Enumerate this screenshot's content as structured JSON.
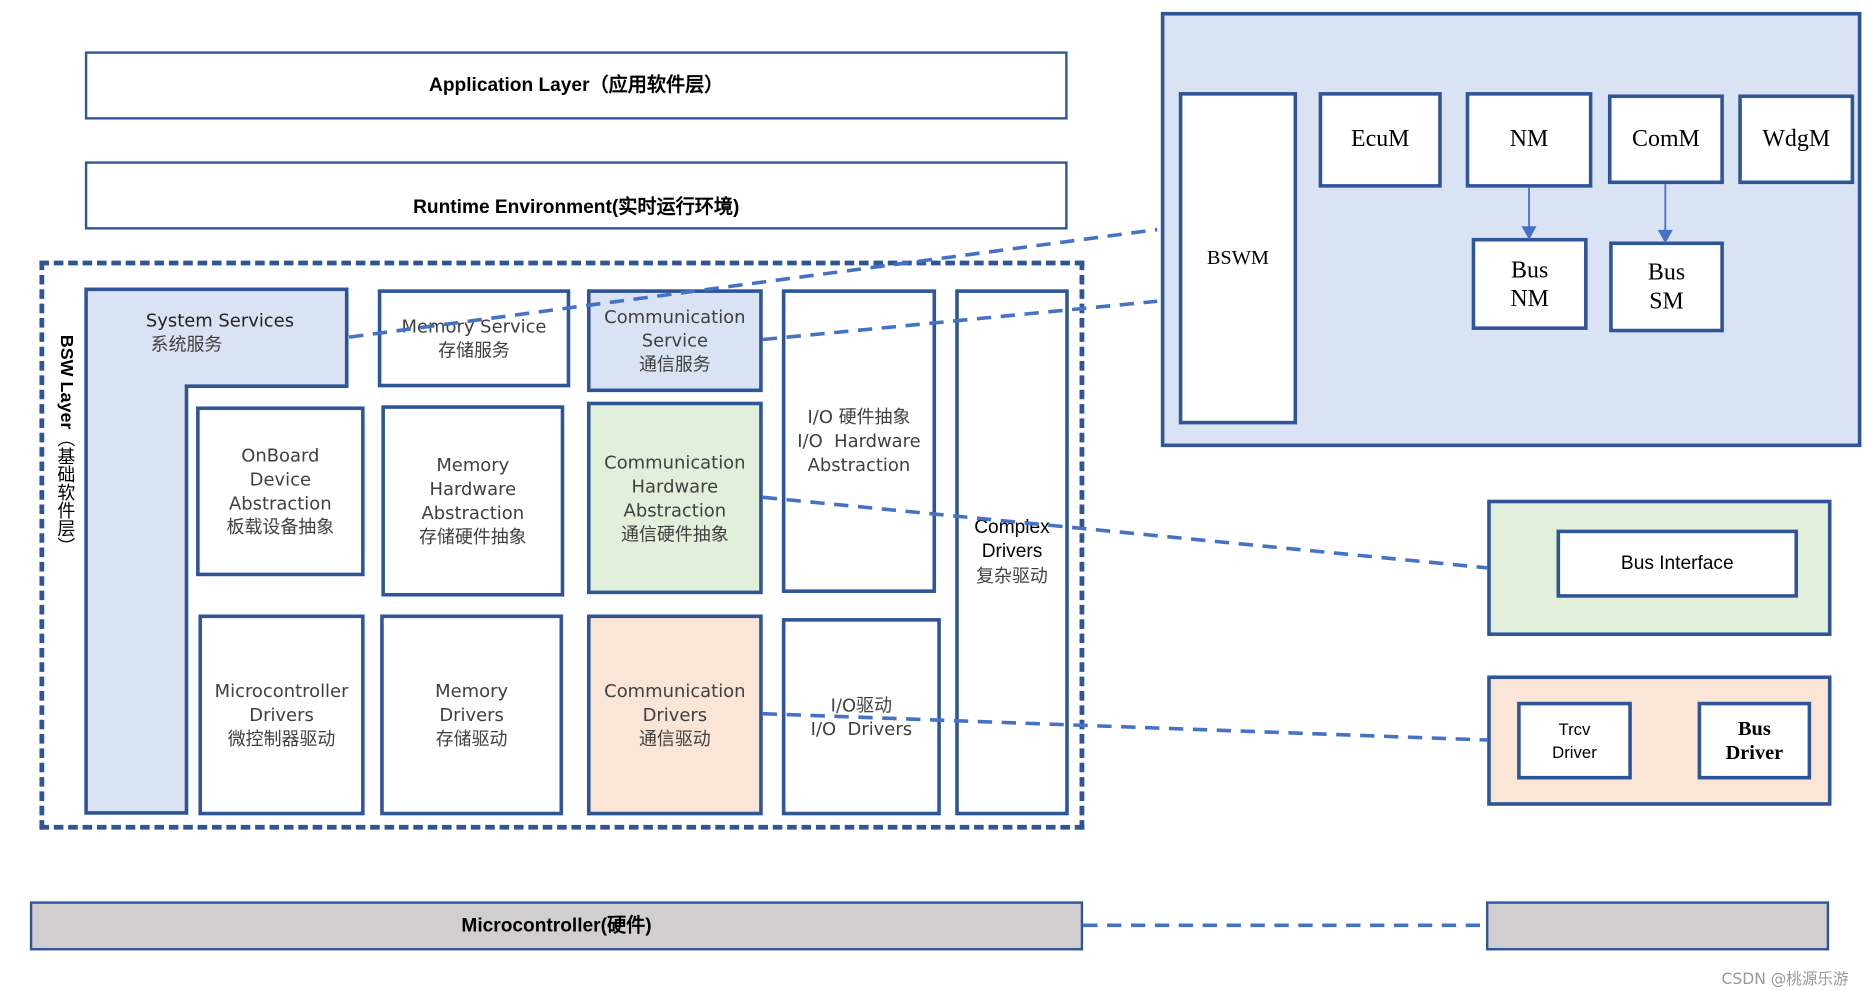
{
  "layers": {
    "application": "Application Layer（应用软件层）",
    "rte": "Runtime Environment(实时运行环境)",
    "bsw_label_en": "BSW  Layer",
    "bsw_label_cn": "（基础软件层）",
    "microcontroller": "Microcontroller(硬件)"
  },
  "bsw": {
    "system_services": [
      "System Services",
      "系统服务"
    ],
    "memory_service": [
      "Memory Service",
      "存储服务"
    ],
    "communication_service": [
      "Communication",
      "Service",
      "通信服务"
    ],
    "io_hw_abstraction": [
      "I/O 硬件抽象",
      "I/O  Hardware",
      "Abstraction"
    ],
    "complex_drivers": [
      "Complex",
      "Drivers",
      "复杂驱动"
    ],
    "onboard_device_abstraction": [
      "OnBoard",
      "Device",
      "Abstraction",
      "板载设备抽象"
    ],
    "memory_hw_abstraction": [
      "Memory",
      "Hardware",
      "Abstraction",
      "存储硬件抽象"
    ],
    "communication_hw_abstraction": [
      "Communication",
      "Hardware",
      "Abstraction",
      "通信硬件抽象"
    ],
    "microcontroller_drivers": [
      "Microcontroller",
      "Drivers",
      "微控制器驱动"
    ],
    "memory_drivers": [
      "Memory",
      "Drivers",
      "存储驱动"
    ],
    "communication_drivers": [
      "Communication",
      "Drivers",
      "通信驱动"
    ],
    "io_drivers": [
      "I/O驱动",
      "I/O  Drivers"
    ]
  },
  "service_detail": {
    "bswm": "BSWM",
    "ecum": "EcuM",
    "nm": "NM",
    "comm": "ComM",
    "wdgm": "WdgM",
    "bus_nm": [
      "Bus",
      "NM"
    ],
    "bus_sm": [
      "Bus",
      "SM"
    ]
  },
  "hw_abstraction_detail": {
    "bus_interface": "Bus Interface"
  },
  "driver_detail": {
    "trcv_driver": [
      "Trcv",
      "Driver"
    ],
    "bus_driver": [
      "Bus",
      "Driver"
    ]
  },
  "watermark": "CSDN @桃源乐游",
  "colors": {
    "border": "#2f5597",
    "connector": "#4472c4",
    "service_fill": "#dae3f3",
    "hw_abstraction_fill": "#e2efda",
    "driver_fill": "#fbe5d6",
    "hardware_fill": "#d0cece"
  }
}
